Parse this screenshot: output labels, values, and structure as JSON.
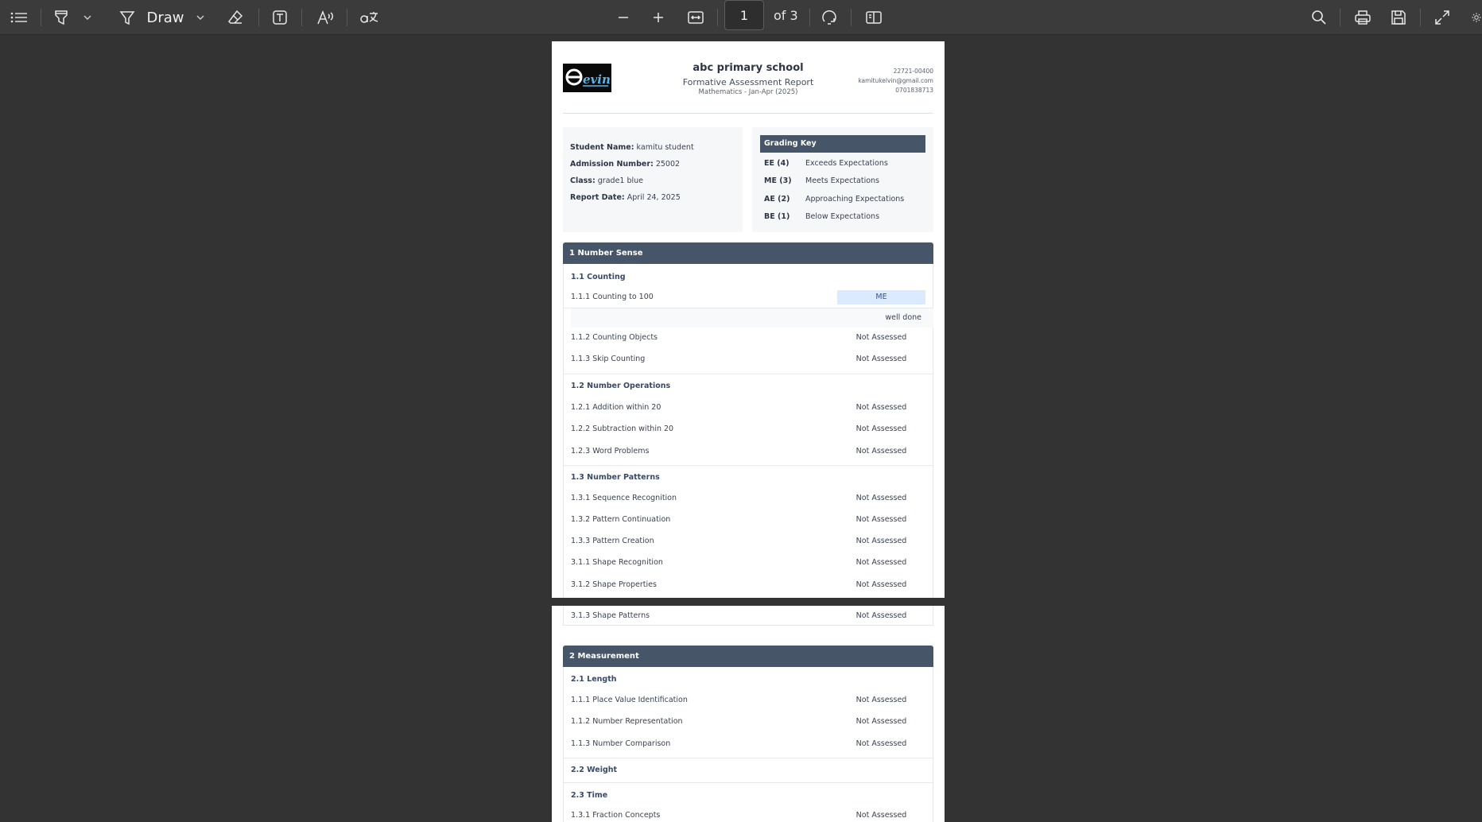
{
  "toolbar": {
    "draw_label": "Draw",
    "page_current": "1",
    "page_total": "of 3"
  },
  "doc": {
    "school_name": "abc primary school",
    "report_title": "Formative Assessment Report",
    "report_subtitle": "Mathematics - Jan-Apr (2025)",
    "logo_text": "evin",
    "contact": {
      "box": "22721-00400",
      "email": "kamitukelvin@gmail.com",
      "phone": "0701838713"
    },
    "student": {
      "name_label": "Student Name:",
      "name": "kamitu student",
      "adm_label": "Admission Number:",
      "adm": "25002",
      "class_label": "Class:",
      "class": "grade1 blue",
      "date_label": "Report Date:",
      "date": "April 24, 2025"
    },
    "grading_key": {
      "title": "Grading Key",
      "rows": [
        {
          "code": "EE (4)",
          "desc": "Exceeds Expectations"
        },
        {
          "code": "ME (3)",
          "desc": "Meets Expectations"
        },
        {
          "code": "AE (2)",
          "desc": "Approaching Expectations"
        },
        {
          "code": "BE (1)",
          "desc": "Below Expectations"
        }
      ]
    },
    "strand1": {
      "title": "1 Number Sense",
      "sub1": {
        "title": "1.1 Counting",
        "items": [
          {
            "name": "1.1.1 Counting to 100",
            "grade": "ME"
          },
          {
            "name": "1.1.2 Counting Objects",
            "grade": "Not Assessed"
          },
          {
            "name": "1.1.3 Skip Counting",
            "grade": "Not Assessed"
          }
        ],
        "comment": "well done"
      },
      "sub2": {
        "title": "1.2 Number Operations",
        "items": [
          {
            "name": "1.2.1 Addition within 20",
            "grade": "Not Assessed"
          },
          {
            "name": "1.2.2 Subtraction within 20",
            "grade": "Not Assessed"
          },
          {
            "name": "1.2.3 Word Problems",
            "grade": "Not Assessed"
          }
        ]
      },
      "sub3": {
        "title": "1.3 Number Patterns",
        "items": [
          {
            "name": "1.3.1 Sequence Recognition",
            "grade": "Not Assessed"
          },
          {
            "name": "1.3.2 Pattern Continuation",
            "grade": "Not Assessed"
          },
          {
            "name": "1.3.3 Pattern Creation",
            "grade": "Not Assessed"
          },
          {
            "name": "3.1.1 Shape Recognition",
            "grade": "Not Assessed"
          },
          {
            "name": "3.1.2 Shape Properties",
            "grade": "Not Assessed"
          },
          {
            "name": "3.1.3 Shape Patterns",
            "grade": "Not Assessed"
          }
        ]
      }
    },
    "strand2": {
      "title": "2 Measurement",
      "sub1": {
        "title": "2.1 Length",
        "items": [
          {
            "name": "1.1.1 Place Value Identification",
            "grade": "Not Assessed"
          },
          {
            "name": "1.1.2 Number Representation",
            "grade": "Not Assessed"
          },
          {
            "name": "1.1.3 Number Comparison",
            "grade": "Not Assessed"
          }
        ]
      },
      "sub2": {
        "title": "2.2 Weight"
      },
      "sub3": {
        "title": "2.3 Time",
        "items": [
          {
            "name": "1.3.1 Fraction Concepts",
            "grade": "Not Assessed"
          }
        ]
      }
    }
  }
}
